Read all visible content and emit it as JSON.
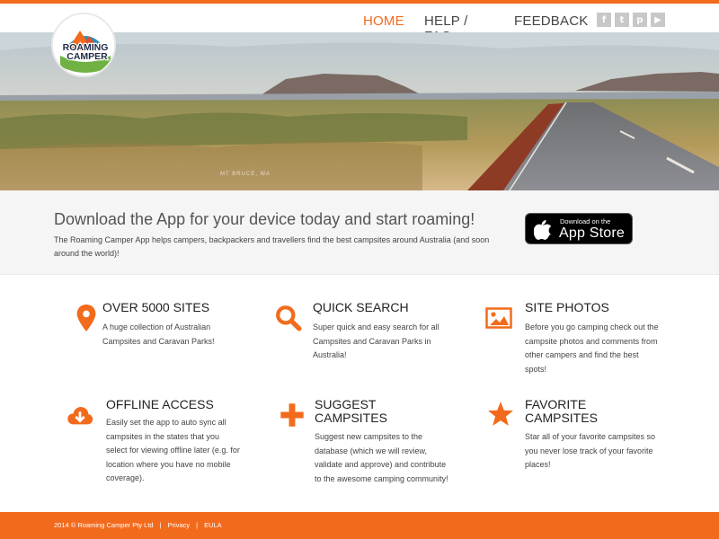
{
  "brand": {
    "logo_line1": "ROAMING",
    "logo_line2": "CAMPER",
    "accent_color": "#f26b1d"
  },
  "nav": {
    "items": [
      {
        "label": "HOME",
        "active": true
      },
      {
        "label": "HELP / FAQ",
        "active": false
      },
      {
        "label": "FEEDBACK",
        "active": false
      }
    ]
  },
  "social": [
    {
      "icon": "facebook-icon",
      "glyph": "f"
    },
    {
      "icon": "twitter-icon",
      "glyph": "t"
    },
    {
      "icon": "pinterest-icon",
      "glyph": "p"
    },
    {
      "icon": "youtube-icon",
      "glyph": "▶"
    }
  ],
  "hero": {
    "caption": "MT BRUCE, WA"
  },
  "cta": {
    "heading": "Download the App for your device today and start roaming!",
    "body": "The Roaming Camper App helps campers, backpackers and travellers find the best campsites around Australia (and soon around the world)!",
    "appstore_small": "Download on the",
    "appstore_big": "App Store"
  },
  "features": [
    {
      "icon": "map-pin-icon",
      "title": "OVER 5000 SITES",
      "text": "A huge collection of Australian Campsites and Caravan Parks!"
    },
    {
      "icon": "search-icon",
      "title": "QUICK SEARCH",
      "text": "Super quick and easy search for all Campsites and Caravan Parks in Australia!"
    },
    {
      "icon": "photo-icon",
      "title": "SITE PHOTOS",
      "text": "Before you go camping check out the campsite photos and comments from other campers and find the best spots!"
    },
    {
      "icon": "cloud-download-icon",
      "title": "OFFLINE ACCESS",
      "text": "Easily set the app to auto sync all campsites in the states that you select for viewing offline later (e.g. for location where you have no mobile coverage)."
    },
    {
      "icon": "plus-icon",
      "title": "SUGGEST CAMPSITES",
      "text": "Suggest new campsites to the database (which we will review, validate and approve) and contribute to the awesome camping community!"
    },
    {
      "icon": "star-icon",
      "title": "FAVORITE CAMPSITES",
      "text": "Star all of your favorite campsites so you never lose track of your favorite places!"
    }
  ],
  "footer": {
    "copyright": "2014 © Roaming Camper Pty Ltd",
    "sep": "|",
    "privacy": "Privacy",
    "eula": "EULA"
  }
}
